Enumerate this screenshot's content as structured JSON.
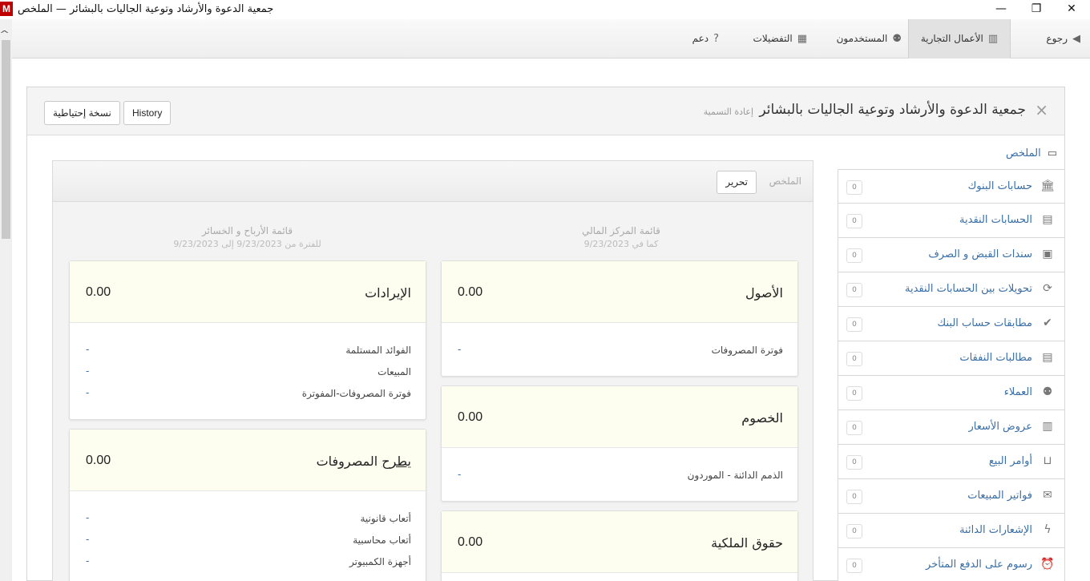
{
  "window": {
    "logo": "M",
    "title": "جمعية الدعوة والأرشاد وتوعية الجاليات بالبشائر — الملخص",
    "minimize": "—",
    "restore": "❐",
    "close": "✕"
  },
  "topnav": {
    "back": "رجوع",
    "business": "الأعمال التجارية",
    "users": "المستخدمون",
    "preferences": "التفضيلات",
    "support": "دعم"
  },
  "header": {
    "title": "جمعية الدعوة والأرشاد وتوعية الجاليات بالبشائر",
    "rename": "إعادة التسمية",
    "history": "History",
    "backup": "نسخة إحتياطية"
  },
  "sidebar": {
    "summary": "الملخص",
    "items": [
      {
        "label": "حسابات البنوك",
        "count": "0",
        "icon": "bank-icon"
      },
      {
        "label": "الحسابات النقدية",
        "count": "0",
        "icon": "cash-register-icon"
      },
      {
        "label": "سندات القبض و الصرف",
        "count": "0",
        "icon": "voucher-icon"
      },
      {
        "label": "تحويلات بين الحسابات النقدية",
        "count": "0",
        "icon": "transfer-icon"
      },
      {
        "label": "مطابقات حساب البنك",
        "count": "0",
        "icon": "check-icon"
      },
      {
        "label": "مطالبات النفقات",
        "count": "0",
        "icon": "expense-claims-icon"
      },
      {
        "label": "العملاء",
        "count": "0",
        "icon": "customers-icon"
      },
      {
        "label": "عروض الأسعار",
        "count": "0",
        "icon": "quote-icon"
      },
      {
        "label": "أوامر البيع",
        "count": "0",
        "icon": "basket-icon"
      },
      {
        "label": "فواتير المبيعات",
        "count": "0",
        "icon": "invoice-icon"
      },
      {
        "label": "الإشعارات الدائنة",
        "count": "0",
        "icon": "lightning-icon"
      },
      {
        "label": "رسوم على الدفع المتأخر",
        "count": "0",
        "icon": "alarm-icon"
      }
    ]
  },
  "content": {
    "title": "الملخص",
    "edit": "تحرير",
    "balance_sheet": {
      "title": "قائمة المركز المالي",
      "subtitle": "كما في 9/23/2023",
      "assets": {
        "title": "الأصول",
        "value": "0.00",
        "rows": [
          {
            "label": "فوترة المصروفات",
            "value": "-"
          }
        ]
      },
      "liabilities": {
        "title": "الخصوم",
        "value": "0.00",
        "rows": [
          {
            "label": "الذمم الدائنة - الموردون",
            "value": "-"
          }
        ]
      },
      "equity": {
        "title": "حقوق الملكية",
        "value": "0.00"
      }
    },
    "pnl": {
      "title": "قائمة الأرباح و الخسائر",
      "subtitle": "للفترة من 9/23/2023 إلى 9/23/2023",
      "income": {
        "title": "الإيرادات",
        "value": "0.00",
        "rows": [
          {
            "label": "الفوائد المستلمة",
            "value": "-"
          },
          {
            "label": "المبيعات",
            "value": "-"
          },
          {
            "label": "فوترة المصروفات-المفوترة",
            "value": "-"
          }
        ]
      },
      "expenses": {
        "title_prefix": "يطرح",
        "title_rest": " المصروفات",
        "value": "0.00",
        "rows": [
          {
            "label": "أتعاب قانونية",
            "value": "-"
          },
          {
            "label": "أتعاب محاسبية",
            "value": "-"
          },
          {
            "label": "أجهزة الكمبيوتر",
            "value": "-"
          }
        ]
      }
    }
  }
}
